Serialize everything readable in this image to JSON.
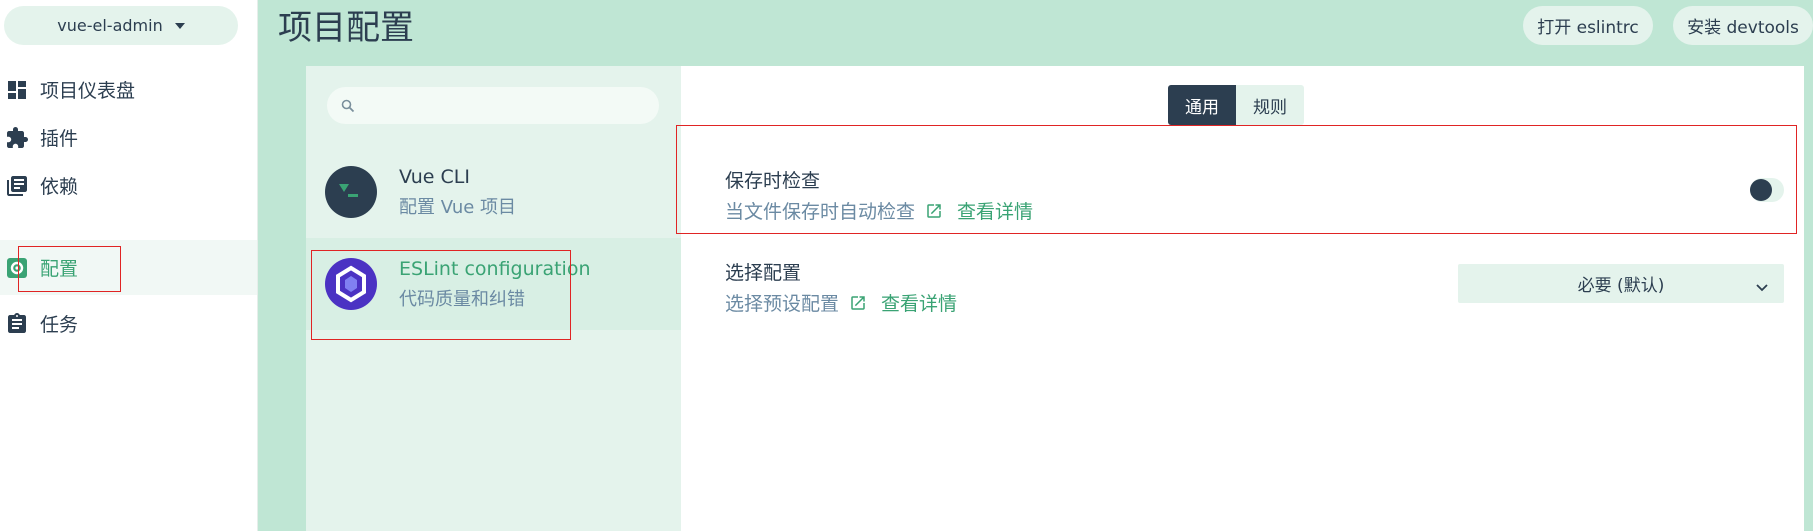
{
  "sidebar": {
    "project_name": "vue-el-admin",
    "items": [
      {
        "label": "项目仪表盘",
        "icon": "dashboard-icon",
        "active": false
      },
      {
        "label": "插件",
        "icon": "puzzle-icon",
        "active": false
      },
      {
        "label": "依赖",
        "icon": "library-books-icon",
        "active": false
      },
      {
        "label": "配置",
        "icon": "settings-icon",
        "active": true
      },
      {
        "label": "任务",
        "icon": "assignment-icon",
        "active": false
      }
    ]
  },
  "header": {
    "title": "项目配置",
    "buttons": {
      "open_eslintrc": "打开 eslintrc",
      "install_devtools": "安装 devtools"
    }
  },
  "config_list": {
    "search_placeholder": "",
    "items": [
      {
        "title": "Vue CLI",
        "subtitle": "配置 Vue 项目",
        "active": false
      },
      {
        "title": "ESLint configuration",
        "subtitle": "代码质量和纠错",
        "active": true
      }
    ]
  },
  "tabs": [
    {
      "label": "通用",
      "active": true
    },
    {
      "label": "规则",
      "active": false
    }
  ],
  "settings": [
    {
      "name": "保存时检查",
      "description": "当文件保存时自动检查",
      "link": "查看详情",
      "toggle_on": false
    },
    {
      "name": "选择配置",
      "description": "选择预设配置",
      "link": "查看详情",
      "select_value": "必要 (默认)"
    }
  ],
  "colors": {
    "accent": "#3aa374",
    "dark": "#2c3e50",
    "background": "#bfe6d4",
    "light": "#e4f3ec",
    "highlight": "#e02424"
  }
}
